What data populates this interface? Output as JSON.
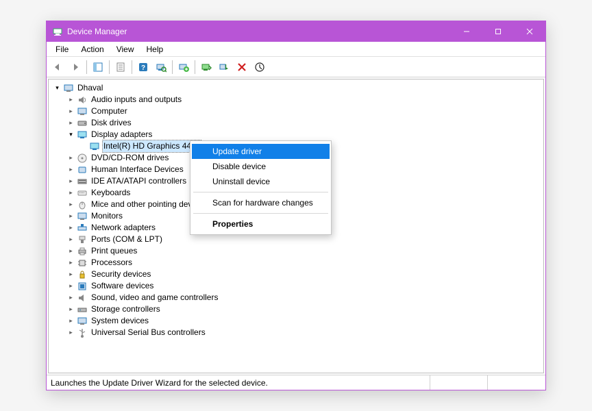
{
  "title": "Device Manager",
  "menu": {
    "file": "File",
    "action": "Action",
    "view": "View",
    "help": "Help"
  },
  "tree": {
    "root": "Dhaval",
    "items": [
      "Audio inputs and outputs",
      "Computer",
      "Disk drives",
      "Display adapters",
      "Intel(R) HD Graphics 4400",
      "DVD/CD-ROM drives",
      "Human Interface Devices",
      "IDE ATA/ATAPI controllers",
      "Keyboards",
      "Mice and other pointing devices",
      "Monitors",
      "Network adapters",
      "Ports (COM & LPT)",
      "Print queues",
      "Processors",
      "Security devices",
      "Software devices",
      "Sound, video and game controllers",
      "Storage controllers",
      "System devices",
      "Universal Serial Bus controllers"
    ]
  },
  "ctx": {
    "update": "Update driver",
    "disable": "Disable device",
    "uninstall": "Uninstall device",
    "scan": "Scan for hardware changes",
    "props": "Properties"
  },
  "status": "Launches the Update Driver Wizard for the selected device."
}
